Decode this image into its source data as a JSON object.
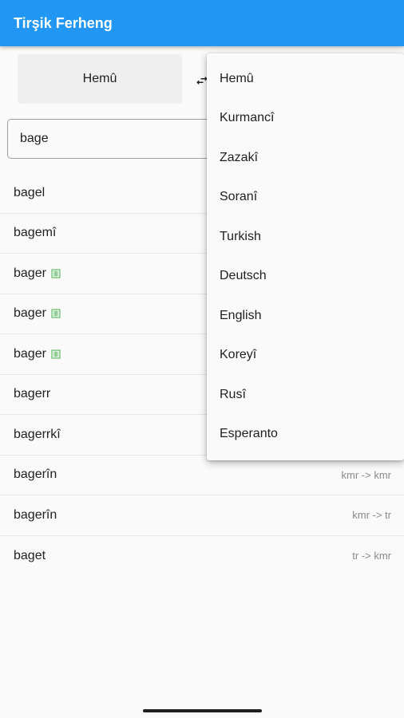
{
  "app": {
    "title": "Tirşik Ferheng"
  },
  "source_language": {
    "label": "Hemû"
  },
  "search": {
    "value": "bage"
  },
  "results": [
    {
      "word": "bagel",
      "direction": "",
      "icon": false
    },
    {
      "word": "bagemî",
      "direction": "",
      "icon": false
    },
    {
      "word": "bager",
      "direction": "",
      "icon": true
    },
    {
      "word": "bager",
      "direction": "",
      "icon": true
    },
    {
      "word": "bager",
      "direction": "",
      "icon": true
    },
    {
      "word": "bagerr",
      "direction": "",
      "icon": false
    },
    {
      "word": "bagerrkî",
      "direction": "",
      "icon": false
    },
    {
      "word": "bagerîn",
      "direction": "kmr -> kmr",
      "icon": false
    },
    {
      "word": "bagerîn",
      "direction": "kmr -> tr",
      "icon": false
    },
    {
      "word": "baget",
      "direction": "tr -> kmr",
      "icon": false
    }
  ],
  "language_menu": {
    "items": [
      "Hemû",
      "Kurmancî",
      "Zazakî",
      "Soranî",
      "Turkish",
      "Deutsch",
      "English",
      "Koreyî",
      "Rusî",
      "Esperanto"
    ]
  },
  "colors": {
    "appbar": "#2196f3",
    "book_icon": "#4caf50"
  },
  "icons": {
    "swap": "swap-horiz-icon",
    "book": "book-icon"
  }
}
